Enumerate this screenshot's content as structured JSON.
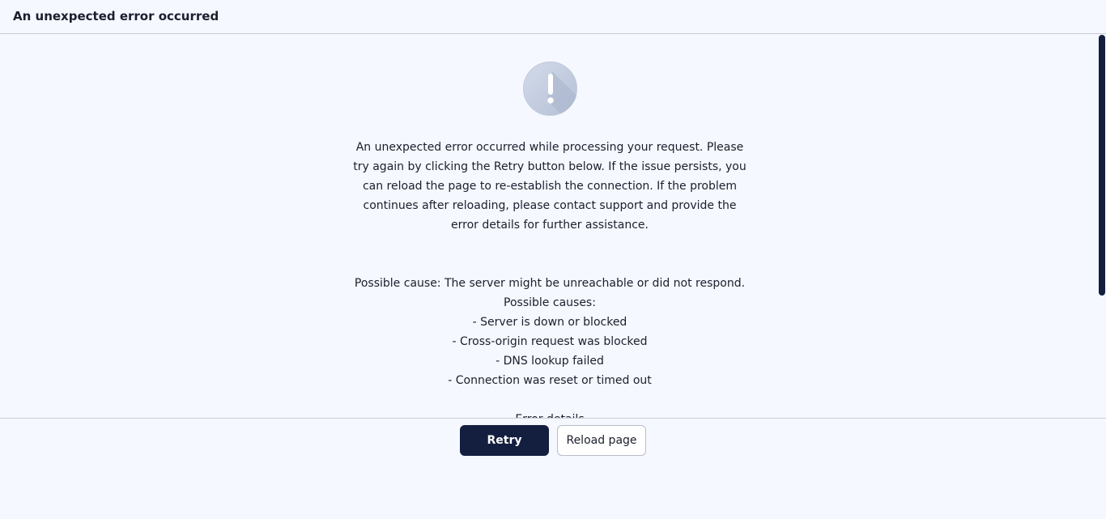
{
  "header": {
    "title": "An unexpected error occurred"
  },
  "body": {
    "icon": "alert-exclamation-icon",
    "message": "An unexpected error occurred while processing your request. Please try again by clicking the Retry button below. If the issue persists, you can reload the page to re-establish the connection. If the problem continues after reloading, please contact support and provide the error details for further assistance.",
    "possible_cause": "Possible cause: The server might be unreachable or did not respond.",
    "possible_causes_label": "Possible causes:",
    "causes": [
      "- Server is down or blocked",
      "- Cross-origin request was blocked",
      "- DNS lookup failed",
      "- Connection was reset or timed out"
    ],
    "error_details_label": "Error details"
  },
  "footer": {
    "retry_label": "Retry",
    "reload_label": "Reload page"
  },
  "colors": {
    "background": "#f5f8fe",
    "primary": "#141e3f",
    "border": "#c8cdd6",
    "icon": "#c7d0e4"
  }
}
